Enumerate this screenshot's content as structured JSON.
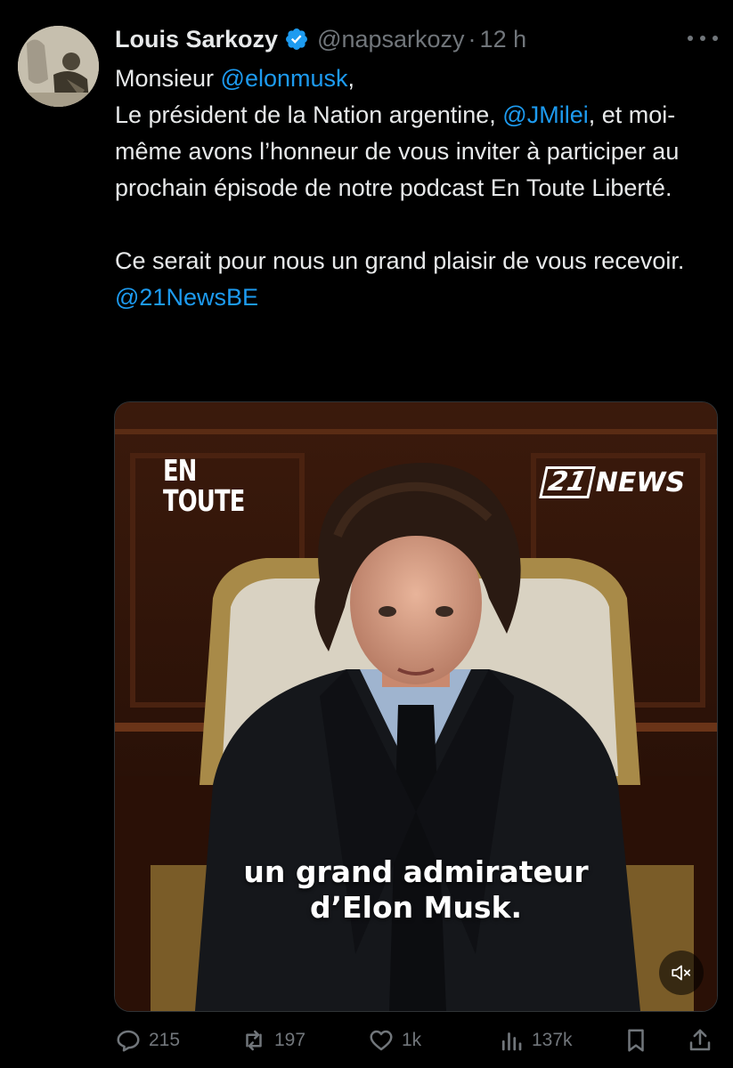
{
  "tweet": {
    "author_name": "Louis Sarkozy",
    "handle": "@napsarkozy",
    "separator": "·",
    "time": "12 h",
    "lines": {
      "greeting_prefix": "Monsieur ",
      "greeting_mention": "@elonmusk",
      "greeting_suffix": ",",
      "para1_a": "Le président de la Nation argentine, ",
      "para1_mention": "@JMilei",
      "para1_b": ", et moi-même avons l’honneur de vous inviter à participer au prochain épisode de notre podcast En Toute Liberté.",
      "para2": "Ce serait pour nous un grand plaisir de vous recevoir.",
      "tag": "@21NewsBE"
    }
  },
  "media": {
    "logo_left_line1": "EN",
    "logo_left_line2": "TOUTE",
    "logo_right_num": "21",
    "logo_right_text": "NEWS",
    "caption_line1": "un grand admirateur",
    "caption_line2": "d’Elon Musk."
  },
  "actions": {
    "replies": "215",
    "reposts": "197",
    "likes": "1k",
    "views": "137k"
  },
  "colors": {
    "background": "#000000",
    "text": "#e7e9ea",
    "muted": "#71767b",
    "link": "#1d9bf0",
    "verified": "#1d9bf0"
  }
}
